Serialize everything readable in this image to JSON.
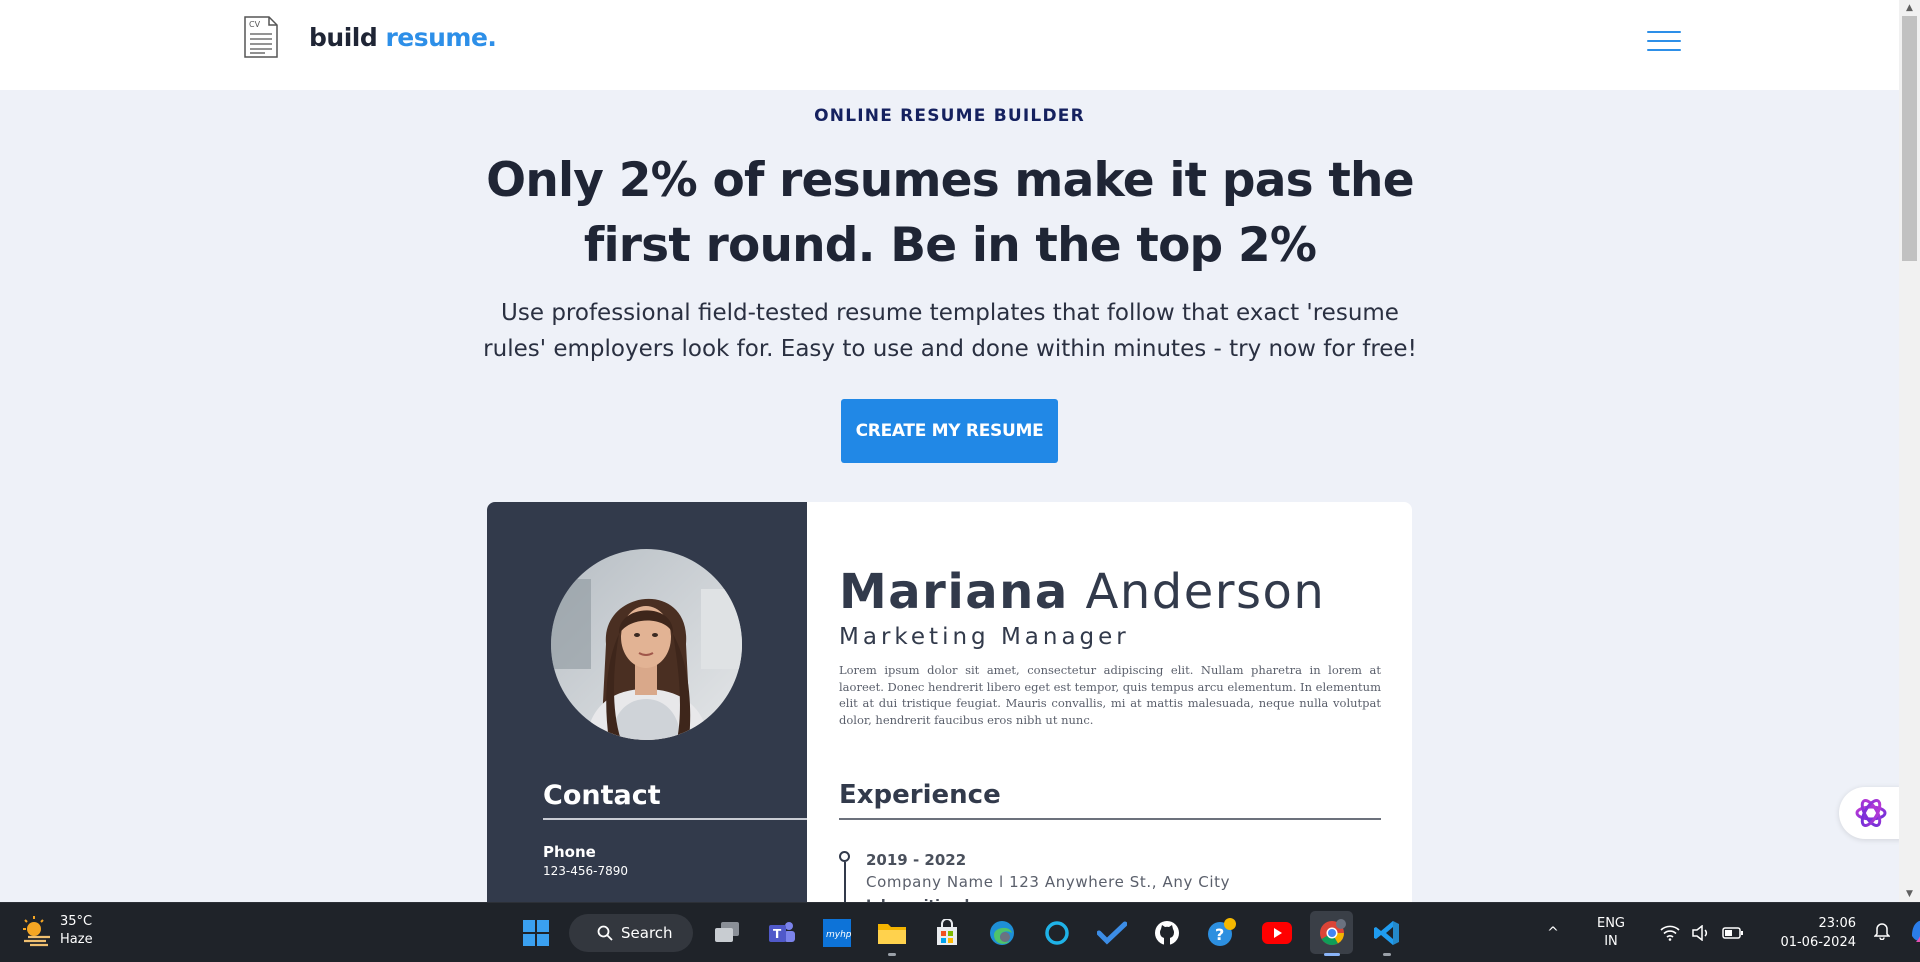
{
  "header": {
    "brand_main": "build",
    "brand_accent": "resume.",
    "brand_icon_text": "CV"
  },
  "hero": {
    "eyebrow": "ONLINE RESUME BUILDER",
    "headline": "Only 2% of resumes make it pas the first round. Be in the top 2%",
    "subtext": "Use professional field-tested resume templates that follow that exact 'resume rules' employers look for. Easy to use and done within minutes - try now for free!",
    "cta_label": "CREATE MY RESUME"
  },
  "resume": {
    "first_name": "Mariana",
    "last_name": "Anderson",
    "role": "Marketing Manager",
    "summary": "Lorem ipsum dolor sit amet, consectetur adipiscing elit. Nullam pharetra in lorem at laoreet. Donec hendrerit libero eget est tempor, quis tempus arcu elementum. In elementum elit at dui tristique feugiat. Mauris convallis, mi at mattis malesuada, neque nulla volutpat dolor, hendrerit faucibus eros nibh ut nunc.",
    "contact_heading": "Contact",
    "phone_label": "Phone",
    "phone_value": "123-456-7890",
    "experience_heading": "Experience",
    "experience": [
      {
        "years": "2019 - 2022",
        "company": "Company Name l 123 Anywhere St., Any City"
      }
    ],
    "experience_partial": "Job position here"
  },
  "taskbar": {
    "temperature": "35°C",
    "weather": "Haze",
    "search_label": "Search",
    "language_top": "ENG",
    "language_bottom": "IN",
    "time": "23:06",
    "date": "01-06-2024",
    "apps": [
      "start-icon",
      "search",
      "task-view-icon",
      "teams-icon",
      "myhp-icon",
      "file-explorer-icon",
      "microsoft-store-icon",
      "edge-icon",
      "cortana-icon",
      "todo-icon",
      "github-icon",
      "help-icon",
      "youtube-icon",
      "chrome-icon",
      "vscode-icon"
    ]
  },
  "colors": {
    "accent": "#2188e6",
    "dark_panel": "#323a4b",
    "page_bg": "#eef1f8"
  }
}
